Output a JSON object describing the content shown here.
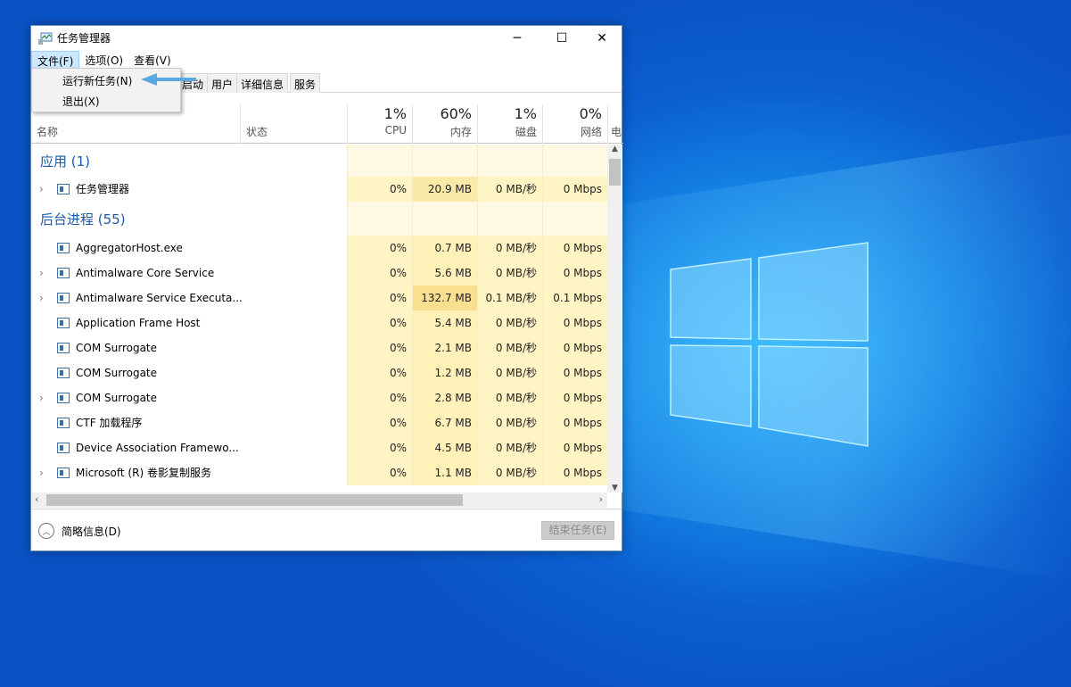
{
  "window": {
    "title": "任务管理器",
    "minimize": "─",
    "maximize": "☐",
    "close": "✕"
  },
  "menubar": [
    "文件(F)",
    "选项(O)",
    "查看(V)"
  ],
  "file_menu": [
    "运行新任务(N)",
    "退出(X)"
  ],
  "tabs": [
    "启动",
    "用户",
    "详细信息",
    "服务"
  ],
  "columns": {
    "name": "名称",
    "status": "状态",
    "cpu": {
      "pct": "1%",
      "label": "CPU"
    },
    "memory": {
      "pct": "60%",
      "label": "内存"
    },
    "disk": {
      "pct": "1%",
      "label": "磁盘"
    },
    "network": {
      "pct": "0%",
      "label": "网络"
    },
    "power": "电"
  },
  "groups": {
    "apps": "应用 (1)",
    "background": "后台进程 (55)"
  },
  "apps": [
    {
      "name": "任务管理器",
      "expand": true,
      "cpu": "0%",
      "mem": "20.9 MB",
      "disk": "0 MB/秒",
      "net": "0 Mbps"
    }
  ],
  "processes": [
    {
      "name": "AggregatorHost.exe",
      "expand": false,
      "cpu": "0%",
      "mem": "0.7 MB",
      "disk": "0 MB/秒",
      "net": "0 Mbps"
    },
    {
      "name": "Antimalware Core Service",
      "expand": true,
      "cpu": "0%",
      "mem": "5.6 MB",
      "disk": "0 MB/秒",
      "net": "0 Mbps"
    },
    {
      "name": "Antimalware Service Executa...",
      "expand": true,
      "cpu": "0%",
      "mem": "132.7 MB",
      "disk": "0.1 MB/秒",
      "net": "0.1 Mbps",
      "hot": true
    },
    {
      "name": "Application Frame Host",
      "expand": false,
      "cpu": "0%",
      "mem": "5.4 MB",
      "disk": "0 MB/秒",
      "net": "0 Mbps"
    },
    {
      "name": "COM Surrogate",
      "expand": false,
      "cpu": "0%",
      "mem": "2.1 MB",
      "disk": "0 MB/秒",
      "net": "0 Mbps"
    },
    {
      "name": "COM Surrogate",
      "expand": false,
      "cpu": "0%",
      "mem": "1.2 MB",
      "disk": "0 MB/秒",
      "net": "0 Mbps"
    },
    {
      "name": "COM Surrogate",
      "expand": true,
      "cpu": "0%",
      "mem": "2.8 MB",
      "disk": "0 MB/秒",
      "net": "0 Mbps"
    },
    {
      "name": "CTF 加载程序",
      "expand": false,
      "cpu": "0%",
      "mem": "6.7 MB",
      "disk": "0 MB/秒",
      "net": "0 Mbps"
    },
    {
      "name": "Device Association Framewo...",
      "expand": false,
      "cpu": "0%",
      "mem": "4.5 MB",
      "disk": "0 MB/秒",
      "net": "0 Mbps"
    },
    {
      "name": "Microsoft (R) 卷影复制服务",
      "expand": true,
      "cpu": "0%",
      "mem": "1.1 MB",
      "disk": "0 MB/秒",
      "net": "0 Mbps"
    }
  ],
  "footer": {
    "fewer_details": "简略信息(D)",
    "end_task": "结束任务(E)"
  }
}
